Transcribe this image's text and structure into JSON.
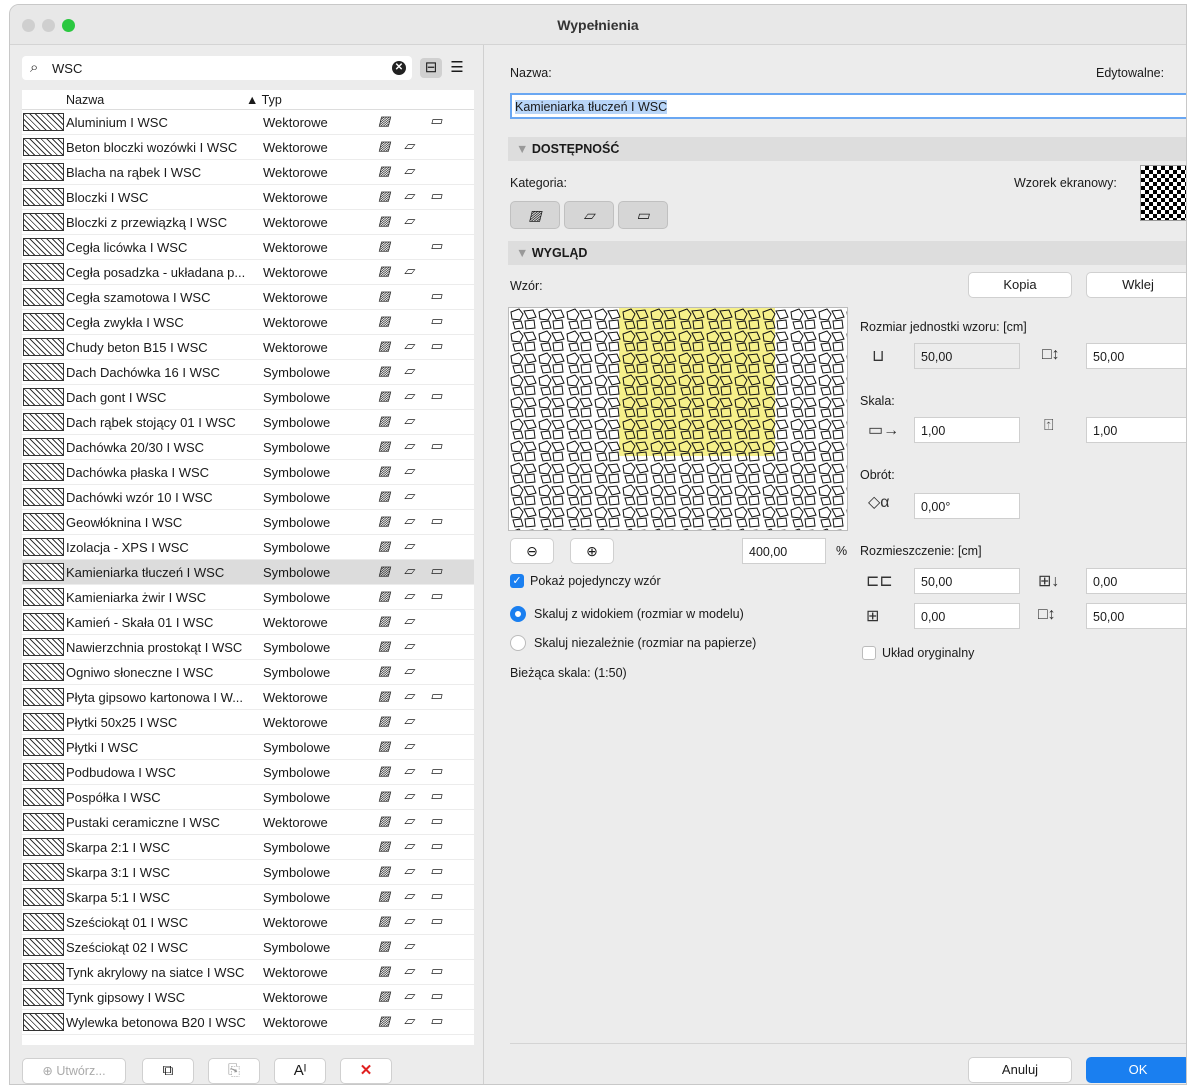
{
  "window": {
    "title": "Wypełnienia"
  },
  "search": {
    "value": "WSC"
  },
  "table": {
    "col_name": "Nazwa",
    "col_type": "▲ Typ",
    "rows": [
      {
        "name": "Aluminium I WSC",
        "type": "Wektorowe",
        "icons": "draft,section"
      },
      {
        "name": "Beton bloczki wozówki I WSC",
        "type": "Wektorowe",
        "icons": "draft,cover"
      },
      {
        "name": "Blacha na rąbek I WSC",
        "type": "Wektorowe",
        "icons": "draft,cover"
      },
      {
        "name": "Bloczki I WSC",
        "type": "Wektorowe",
        "icons": "draft,cover,section"
      },
      {
        "name": "Bloczki z przewiązką I WSC",
        "type": "Wektorowe",
        "icons": "draft,cover"
      },
      {
        "name": "Cegła licówka I WSC",
        "type": "Wektorowe",
        "icons": "draft,section"
      },
      {
        "name": "Cegła posadzka - układana p...",
        "type": "Wektorowe",
        "icons": "draft,cover"
      },
      {
        "name": "Cegła szamotowa I WSC",
        "type": "Wektorowe",
        "icons": "draft,section"
      },
      {
        "name": "Cegła zwykła I WSC",
        "type": "Wektorowe",
        "icons": "draft,section"
      },
      {
        "name": "Chudy beton B15 I WSC",
        "type": "Wektorowe",
        "icons": "draft,cover,section"
      },
      {
        "name": "Dach Dachówka 16 I WSC",
        "type": "Symbolowe",
        "icons": "draft,cover"
      },
      {
        "name": "Dach gont I WSC",
        "type": "Symbolowe",
        "icons": "draft,cover,section"
      },
      {
        "name": "Dach rąbek stojący 01 I WSC",
        "type": "Symbolowe",
        "icons": "draft,cover"
      },
      {
        "name": "Dachówka 20/30 I WSC",
        "type": "Symbolowe",
        "icons": "draft,cover,section"
      },
      {
        "name": "Dachówka płaska I WSC",
        "type": "Symbolowe",
        "icons": "draft,cover"
      },
      {
        "name": "Dachówki wzór 10 I WSC",
        "type": "Symbolowe",
        "icons": "draft,cover"
      },
      {
        "name": "Geowłóknina I WSC",
        "type": "Symbolowe",
        "icons": "draft,cover,section"
      },
      {
        "name": "Izolacja - XPS I WSC",
        "type": "Symbolowe",
        "icons": "draft,cover"
      },
      {
        "name": "Kamieniarka tłuczeń I WSC",
        "type": "Symbolowe",
        "icons": "draft,cover,section",
        "selected": true
      },
      {
        "name": "Kamieniarka żwir I WSC",
        "type": "Symbolowe",
        "icons": "draft,cover,section"
      },
      {
        "name": "Kamień - Skała 01 I WSC",
        "type": "Wektorowe",
        "icons": "draft,cover"
      },
      {
        "name": "Nawierzchnia prostokąt I WSC",
        "type": "Symbolowe",
        "icons": "draft,cover"
      },
      {
        "name": "Ogniwo słoneczne I WSC",
        "type": "Symbolowe",
        "icons": "draft,cover"
      },
      {
        "name": "Płyta gipsowo kartonowa I W...",
        "type": "Wektorowe",
        "icons": "draft,cover,section"
      },
      {
        "name": "Płytki 50x25 I WSC",
        "type": "Wektorowe",
        "icons": "draft,cover"
      },
      {
        "name": "Płytki I WSC",
        "type": "Symbolowe",
        "icons": "draft,cover"
      },
      {
        "name": "Podbudowa I WSC",
        "type": "Symbolowe",
        "icons": "draft,cover,section"
      },
      {
        "name": "Pospółka I WSC",
        "type": "Symbolowe",
        "icons": "draft,cover,section"
      },
      {
        "name": "Pustaki ceramiczne I WSC",
        "type": "Wektorowe",
        "icons": "draft,cover,section"
      },
      {
        "name": "Skarpa 2:1 I WSC",
        "type": "Symbolowe",
        "icons": "draft,cover,section"
      },
      {
        "name": "Skarpa 3:1 I WSC",
        "type": "Symbolowe",
        "icons": "draft,cover,section"
      },
      {
        "name": "Skarpa 5:1 I WSC",
        "type": "Symbolowe",
        "icons": "draft,cover,section"
      },
      {
        "name": "Sześciokąt 01 I WSC",
        "type": "Wektorowe",
        "icons": "draft,cover,section"
      },
      {
        "name": "Sześciokąt 02 I WSC",
        "type": "Symbolowe",
        "icons": "draft,cover"
      },
      {
        "name": "Tynk akrylowy na siatce I WSC",
        "type": "Wektorowe",
        "icons": "draft,cover,section"
      },
      {
        "name": "Tynk gipsowy I WSC",
        "type": "Wektorowe",
        "icons": "draft,cover,section"
      },
      {
        "name": "Wylewka betonowa B20 I WSC",
        "type": "Wektorowe",
        "icons": "draft,cover,section"
      }
    ]
  },
  "bottom": {
    "create": "Utwórz...",
    "font_btn": "Aᴵ"
  },
  "detail": {
    "name_label": "Nazwa:",
    "editable_label": "Edytowalne:",
    "name_value": "Kamieniarka tłuczeń I WSC",
    "sec_access": "DOSTĘPNOŚĆ",
    "category_label": "Kategoria:",
    "screen_pattern_label": "Wzorek ekranowy:",
    "sec_look": "WYGLĄD",
    "pattern_label": "Wzór:",
    "copy_btn": "Kopia",
    "paste_btn": "Wklej",
    "unit_size_label": "Rozmiar jednostki wzoru: [cm]",
    "unit_w": "50,00",
    "unit_h": "50,00",
    "scale_label": "Skala:",
    "scale_x": "1,00",
    "scale_y": "1,00",
    "rotation_label": "Obrót:",
    "rotation": "0,00°",
    "zoom_value": "400,00",
    "zoom_unit": "%",
    "spacing_label": "Rozmieszczenie: [cm]",
    "sp_a": "50,00",
    "sp_b": "0,00",
    "sp_c": "0,00",
    "sp_d": "50,00",
    "show_single": "Pokaż pojedynczy wzór",
    "show_single_checked": true,
    "orig_layout": "Układ oryginalny",
    "orig_layout_checked": false,
    "radio1": "Skaluj z widokiem (rozmiar w modelu)",
    "radio2": "Skaluj niezależnie (rozmiar na papierze)",
    "radio_selected": 1,
    "current_scale": "Bieżąca skala: (1:50)",
    "cancel": "Anuluj",
    "ok": "OK"
  },
  "colors": {
    "accent": "#1a7ff0",
    "highlight": "#f6f08a",
    "traffic_dim": "#cfcfcf",
    "traffic_green": "#2bc840"
  }
}
